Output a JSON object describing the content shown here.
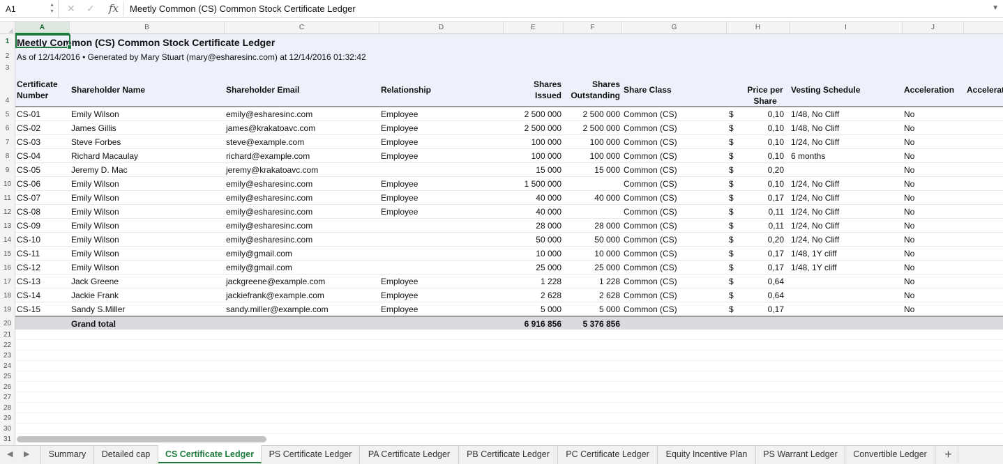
{
  "formula_bar": {
    "cell_ref": "A1",
    "formula": "Meetly Common (CS) Common Stock Certificate Ledger"
  },
  "columns": [
    "A",
    "B",
    "C",
    "D",
    "E",
    "F",
    "G",
    "H",
    "I",
    "J"
  ],
  "row_numbers": [
    "1",
    "2",
    "3",
    "4",
    "5",
    "6",
    "7",
    "8",
    "9",
    "10",
    "11",
    "12",
    "13",
    "14",
    "15",
    "16",
    "17",
    "18",
    "19",
    "20",
    "21",
    "22",
    "23",
    "24",
    "25",
    "26",
    "27",
    "28",
    "29",
    "30",
    "31"
  ],
  "sheet": {
    "title": "Meetly Common (CS) Common Stock Certificate Ledger",
    "subtitle": "As of 12/14/2016 • Generated by Mary Stuart (mary@esharesinc.com) at 12/14/2016 01:32:42",
    "headers": {
      "cert_1": "Certificate",
      "cert_2": "Number",
      "name": "Shareholder Name",
      "email": "Shareholder Email",
      "relationship": "Relationship",
      "issued_1": "Shares",
      "issued_2": "Issued",
      "outstanding_1": "Shares",
      "outstanding_2": "Outstanding",
      "share_class": "Share Class",
      "price_1": "Price per",
      "price_2": "Share",
      "vesting": "Vesting Schedule",
      "acceleration": "Acceleration",
      "acceleration2": "Accelerat"
    },
    "rows": [
      {
        "cert": "CS-01",
        "name": "Emily Wilson",
        "email": "emily@esharesinc.com",
        "rel": "Employee",
        "issued": "2 500 000",
        "outstanding": "2 500 000",
        "cls": "Common (CS)",
        "cur": "$",
        "price": "0,10",
        "vesting": "1/48, No Cliff",
        "accel": "No"
      },
      {
        "cert": "CS-02",
        "name": "James Gillis",
        "email": "james@krakatoavc.com",
        "rel": "Employee",
        "issued": "2 500 000",
        "outstanding": "2 500 000",
        "cls": "Common (CS)",
        "cur": "$",
        "price": "0,10",
        "vesting": "1/48, No Cliff",
        "accel": "No"
      },
      {
        "cert": "CS-03",
        "name": "Steve Forbes",
        "email": "steve@example.com",
        "rel": "Employee",
        "issued": "100 000",
        "outstanding": "100 000",
        "cls": "Common (CS)",
        "cur": "$",
        "price": "0,10",
        "vesting": "1/24, No Cliff",
        "accel": "No"
      },
      {
        "cert": "CS-04",
        "name": "Richard Macaulay",
        "email": "richard@example.com",
        "rel": "Employee",
        "issued": "100 000",
        "outstanding": "100 000",
        "cls": "Common (CS)",
        "cur": "$",
        "price": "0,10",
        "vesting": "6 months",
        "accel": "No"
      },
      {
        "cert": "CS-05",
        "name": "Jeremy D. Mac",
        "email": "jeremy@krakatoavc.com",
        "rel": "",
        "issued": "15 000",
        "outstanding": "15 000",
        "cls": "Common (CS)",
        "cur": "$",
        "price": "0,20",
        "vesting": "",
        "accel": "No"
      },
      {
        "cert": "CS-06",
        "name": "Emily Wilson",
        "email": "emily@esharesinc.com",
        "rel": "Employee",
        "issued": "1 500 000",
        "outstanding": "",
        "cls": "Common (CS)",
        "cur": "$",
        "price": "0,10",
        "vesting": "1/24, No Cliff",
        "accel": "No"
      },
      {
        "cert": "CS-07",
        "name": "Emily Wilson",
        "email": "emily@esharesinc.com",
        "rel": "Employee",
        "issued": "40 000",
        "outstanding": "40 000",
        "cls": "Common (CS)",
        "cur": "$",
        "price": "0,17",
        "vesting": "1/24, No Cliff",
        "accel": "No"
      },
      {
        "cert": "CS-08",
        "name": "Emily Wilson",
        "email": "emily@esharesinc.com",
        "rel": "Employee",
        "issued": "40 000",
        "outstanding": "",
        "cls": "Common (CS)",
        "cur": "$",
        "price": "0,11",
        "vesting": "1/24, No Cliff",
        "accel": "No"
      },
      {
        "cert": "CS-09",
        "name": "Emily Wilson",
        "email": "emily@esharesinc.com",
        "rel": "",
        "issued": "28 000",
        "outstanding": "28 000",
        "cls": "Common (CS)",
        "cur": "$",
        "price": "0,11",
        "vesting": "1/24, No Cliff",
        "accel": "No"
      },
      {
        "cert": "CS-10",
        "name": "Emily Wilson",
        "email": "emily@esharesinc.com",
        "rel": "",
        "issued": "50 000",
        "outstanding": "50 000",
        "cls": "Common (CS)",
        "cur": "$",
        "price": "0,20",
        "vesting": "1/24, No Cliff",
        "accel": "No"
      },
      {
        "cert": "CS-11",
        "name": "Emily Wilson",
        "email": "emily@gmail.com",
        "rel": "",
        "issued": "10 000",
        "outstanding": "10 000",
        "cls": "Common (CS)",
        "cur": "$",
        "price": "0,17",
        "vesting": "1/48, 1Y cliff",
        "accel": "No"
      },
      {
        "cert": "CS-12",
        "name": "Emily Wilson",
        "email": "emily@gmail.com",
        "rel": "",
        "issued": "25 000",
        "outstanding": "25 000",
        "cls": "Common (CS)",
        "cur": "$",
        "price": "0,17",
        "vesting": "1/48, 1Y cliff",
        "accel": "No"
      },
      {
        "cert": "CS-13",
        "name": "Jack Greene",
        "email": "jackgreene@example.com",
        "rel": "Employee",
        "issued": "1 228",
        "outstanding": "1 228",
        "cls": "Common (CS)",
        "cur": "$",
        "price": "0,64",
        "vesting": "",
        "accel": "No"
      },
      {
        "cert": "CS-14",
        "name": "Jackie Frank",
        "email": "jackiefrank@example.com",
        "rel": "Employee",
        "issued": "2 628",
        "outstanding": "2 628",
        "cls": "Common (CS)",
        "cur": "$",
        "price": "0,64",
        "vesting": "",
        "accel": "No"
      },
      {
        "cert": "CS-15",
        "name": "Sandy S.Miller",
        "email": "sandy.miller@example.com",
        "rel": "Employee",
        "issued": "5 000",
        "outstanding": "5 000",
        "cls": "Common (CS)",
        "cur": "$",
        "price": "0,17",
        "vesting": "",
        "accel": "No"
      }
    ],
    "total": {
      "label": "Grand total",
      "issued": "6 916 856",
      "outstanding": "5 376 856"
    }
  },
  "tabs": [
    "Summary",
    "Detailed cap",
    "CS Certificate Ledger",
    "PS Certificate Ledger",
    "PA Certificate Ledger",
    "PB Certificate Ledger",
    "PC Certificate Ledger",
    "Equity Incentive Plan",
    "PS Warrant Ledger",
    "Convertible Ledger"
  ],
  "active_tab": "CS Certificate Ledger",
  "add_tab_label": "+",
  "icons": {
    "cancel": "✕",
    "confirm": "✓",
    "fx": "fx",
    "dropdown": "▼",
    "prev": "◀",
    "next": "▶",
    "spin_up": "▲",
    "spin_down": "▼"
  }
}
